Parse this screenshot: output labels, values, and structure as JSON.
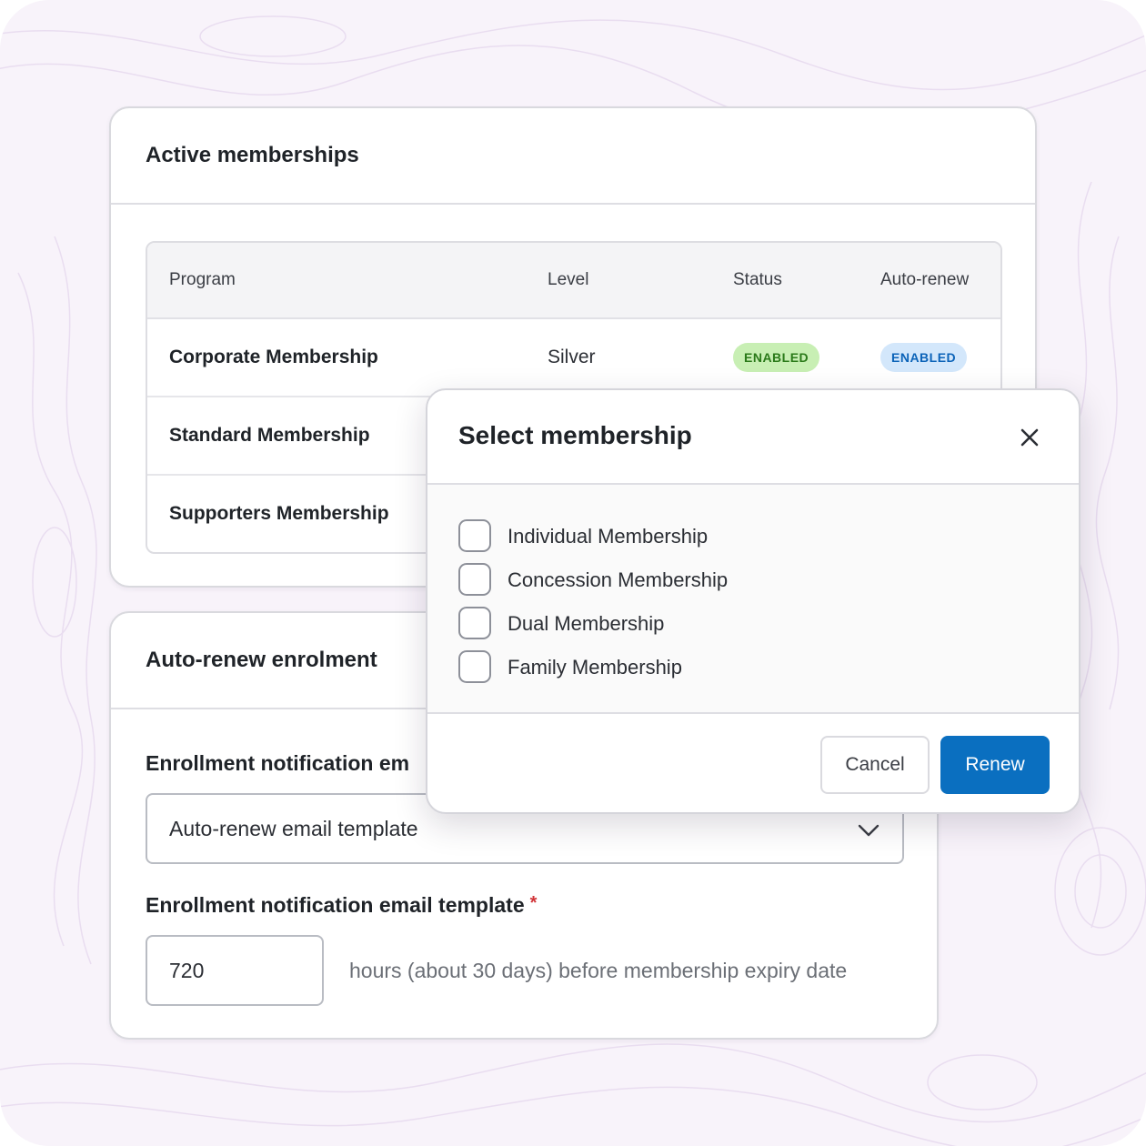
{
  "active_memberships": {
    "title": "Active memberships",
    "columns": [
      "Program",
      "Level",
      "Status",
      "Auto-renew"
    ],
    "rows": [
      {
        "program": "Corporate Membership",
        "level": "Silver",
        "status": "ENABLED",
        "auto_renew": "ENABLED"
      },
      {
        "program": "Standard Membership"
      },
      {
        "program": "Supporters Membership"
      }
    ]
  },
  "auto_renew_enrolment": {
    "title": "Auto-renew enrolment",
    "field1_label": "Enrollment notification em",
    "field1_value": "Auto-renew email template",
    "field2_label": "Enrollment notification email template",
    "required_mark": "*",
    "field2_value": "720",
    "field2_hint": "hours (about 30 days) before membership expiry date"
  },
  "modal": {
    "title": "Select membership",
    "options": [
      "Individual Membership",
      "Concession Membership",
      "Dual Membership",
      "Family Membership"
    ],
    "cancel_label": "Cancel",
    "renew_label": "Renew"
  },
  "colors": {
    "status_badge_bg": "#c8efb4",
    "status_badge_text": "#2a7a19",
    "autorenew_badge_bg": "#d3e7fb",
    "autorenew_badge_text": "#0b63b8",
    "primary": "#0a6fc0",
    "background": "#f8f3fa"
  },
  "icons": {
    "close": "close-icon",
    "dropdown": "chevron-down-icon",
    "background": "topographic-pattern"
  }
}
